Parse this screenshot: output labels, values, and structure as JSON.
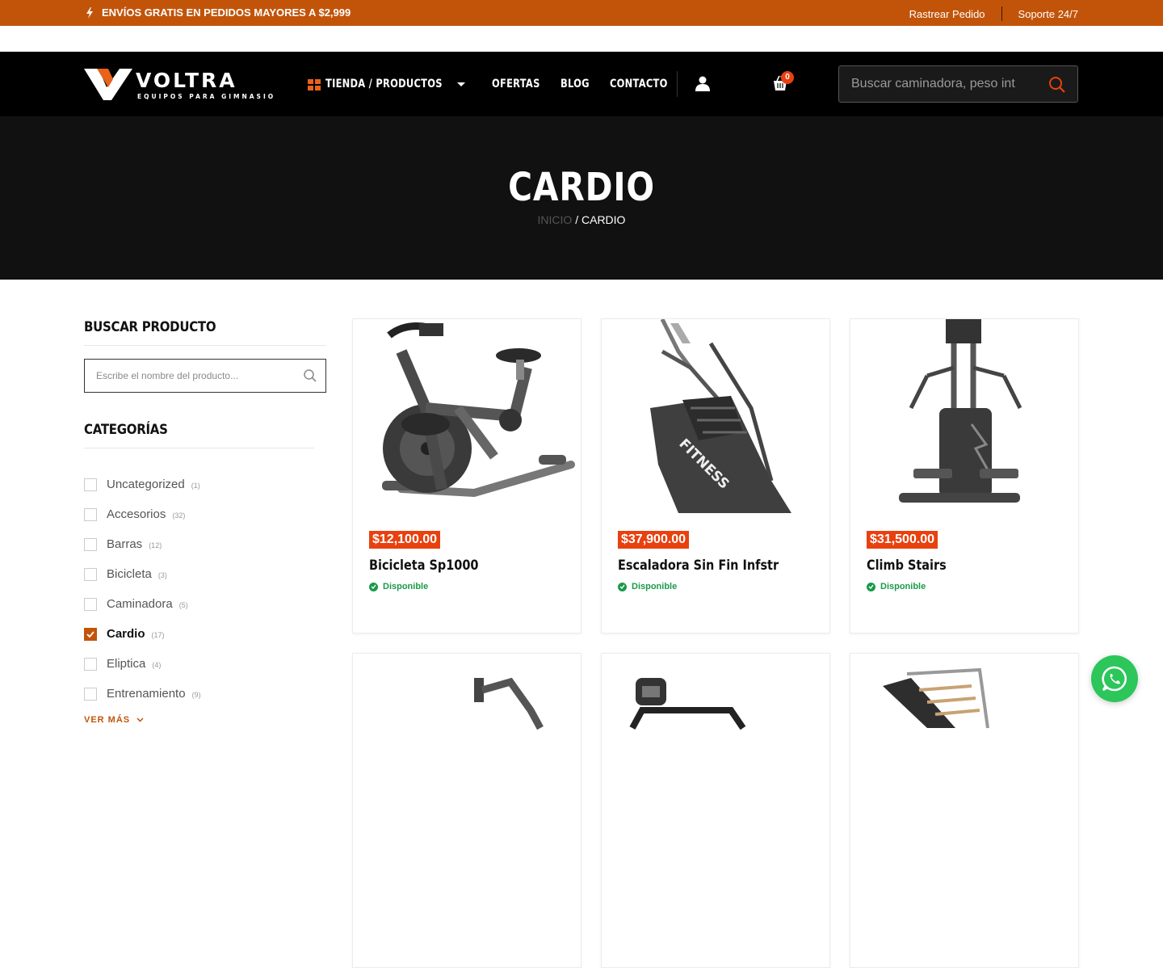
{
  "topbar": {
    "promo": "ENVÍOS GRATIS EN PEDIDOS MAYORES A $2,999",
    "track_order": "Rastrear Pedido",
    "support": "Soporte 24/7"
  },
  "header": {
    "logo_text": "VOLTRA",
    "logo_tagline": "EQUIPOS PARA GIMNASIO",
    "nav_shop": "TIENDA / PRODUCTOS",
    "nav_links": [
      "OFERTAS",
      "BLOG",
      "CONTACTO"
    ],
    "cart_count": "0",
    "search_placeholder": "Buscar caminadora, peso int"
  },
  "hero": {
    "title": "CARDIO",
    "breadcrumb_home": "INICIO",
    "breadcrumb_sep": " / ",
    "breadcrumb_current": "CARDIO"
  },
  "sidebar": {
    "search_title": "BUSCAR PRODUCTO",
    "search_placeholder": "Escribe el nombre del producto...",
    "categories_title": "CATEGORÍAS",
    "categories": [
      {
        "name": "Uncategorized",
        "count": "(1)",
        "checked": false
      },
      {
        "name": "Accesorios",
        "count": "(32)",
        "checked": false
      },
      {
        "name": "Barras",
        "count": "(12)",
        "checked": false
      },
      {
        "name": "Bicicleta",
        "count": "(3)",
        "checked": false
      },
      {
        "name": "Caminadora",
        "count": "(5)",
        "checked": false
      },
      {
        "name": "Cardio",
        "count": "(17)",
        "checked": true
      },
      {
        "name": "Eliptica",
        "count": "(4)",
        "checked": false
      },
      {
        "name": "Entrenamiento",
        "count": "(9)",
        "checked": false
      }
    ],
    "see_more": "VER MÁS"
  },
  "products": [
    {
      "price": "$12,100.00",
      "name": "Bicicleta Sp1000",
      "stock": "Disponible"
    },
    {
      "price": "$37,900.00",
      "name": "Escaladora Sin Fin Infstr",
      "stock": "Disponible"
    },
    {
      "price": "$31,500.00",
      "name": "Climb Stairs",
      "stock": "Disponible"
    }
  ],
  "product_images": {
    "bike_label": "",
    "stair_label": "FITNESS"
  },
  "colors": {
    "accent": "#c2540a",
    "price_bg": "#e8410f",
    "in_stock": "#1a9a4a",
    "whatsapp": "#2cc65a"
  }
}
